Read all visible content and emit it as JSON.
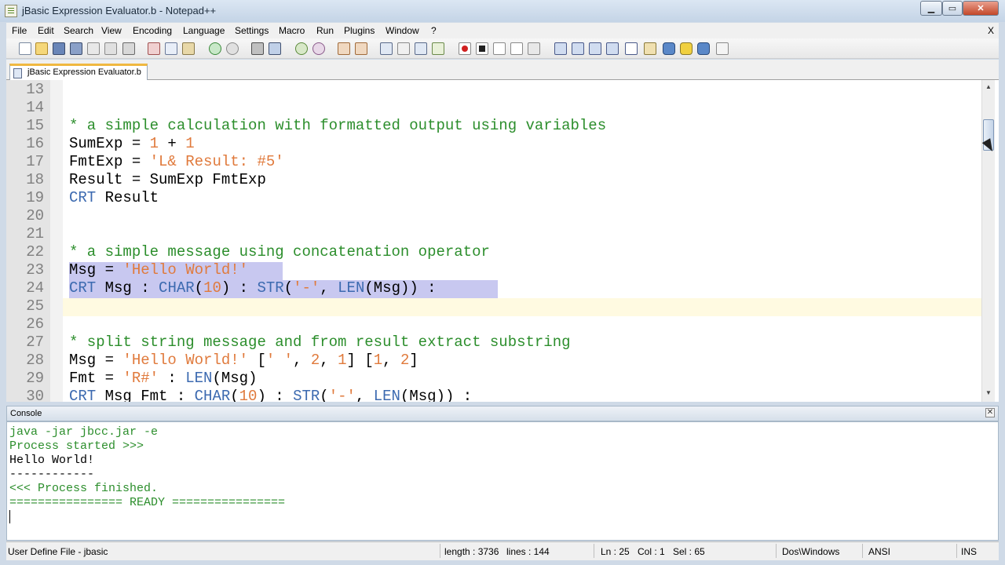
{
  "window": {
    "title": "jBasic Expression Evaluator.b - Notepad++"
  },
  "menu": {
    "items": [
      "File",
      "Edit",
      "Search",
      "View",
      "Encoding",
      "Language",
      "Settings",
      "Macro",
      "Run",
      "Plugins",
      "Window",
      "?"
    ],
    "close_label": "X"
  },
  "tab": {
    "label": "jBasic Expression Evaluator.b"
  },
  "editor": {
    "line_numbers": [
      "13",
      "14",
      "15",
      "16",
      "17",
      "18",
      "19",
      "20",
      "21",
      "22",
      "23",
      "24",
      "25",
      "26",
      "27",
      "28",
      "29",
      "30"
    ],
    "lines": [
      {
        "num": "13",
        "tokens": []
      },
      {
        "num": "14",
        "tokens": []
      },
      {
        "num": "15",
        "tokens": [
          {
            "t": "cm",
            "v": "* a simple calculation with formatted output using variables"
          }
        ]
      },
      {
        "num": "16",
        "tokens": [
          {
            "t": "op",
            "v": "SumExp = "
          },
          {
            "t": "nm",
            "v": "1"
          },
          {
            "t": "op",
            "v": " + "
          },
          {
            "t": "nm",
            "v": "1"
          }
        ]
      },
      {
        "num": "17",
        "tokens": [
          {
            "t": "op",
            "v": "FmtExp = "
          },
          {
            "t": "st",
            "v": "'L& Result: #5'"
          }
        ]
      },
      {
        "num": "18",
        "tokens": [
          {
            "t": "op",
            "v": "Result = SumExp FmtExp"
          }
        ]
      },
      {
        "num": "19",
        "tokens": [
          {
            "t": "kw",
            "v": "CRT"
          },
          {
            "t": "op",
            "v": " Result"
          }
        ]
      },
      {
        "num": "20",
        "tokens": []
      },
      {
        "num": "21",
        "tokens": []
      },
      {
        "num": "22",
        "tokens": [
          {
            "t": "cm",
            "v": "* a simple message using concatenation operator"
          }
        ]
      },
      {
        "num": "23",
        "tokens": [
          {
            "t": "op",
            "v": "Msg = "
          },
          {
            "t": "st",
            "v": "'Hello World!'"
          }
        ]
      },
      {
        "num": "24",
        "tokens": [
          {
            "t": "kw",
            "v": "CRT"
          },
          {
            "t": "op",
            "v": " Msg : "
          },
          {
            "t": "kw",
            "v": "CHAR"
          },
          {
            "t": "op",
            "v": "("
          },
          {
            "t": "nm",
            "v": "10"
          },
          {
            "t": "op",
            "v": ") : "
          },
          {
            "t": "kw",
            "v": "STR"
          },
          {
            "t": "op",
            "v": "("
          },
          {
            "t": "st",
            "v": "'-'"
          },
          {
            "t": "op",
            "v": ", "
          },
          {
            "t": "kw",
            "v": "LEN"
          },
          {
            "t": "op",
            "v": "(Msg)) :"
          }
        ]
      },
      {
        "num": "25",
        "tokens": []
      },
      {
        "num": "26",
        "tokens": []
      },
      {
        "num": "27",
        "tokens": [
          {
            "t": "cm",
            "v": "* split string message and from result extract substring"
          }
        ]
      },
      {
        "num": "28",
        "tokens": [
          {
            "t": "op",
            "v": "Msg = "
          },
          {
            "t": "st",
            "v": "'Hello World!'"
          },
          {
            "t": "op",
            "v": " ["
          },
          {
            "t": "st",
            "v": "' '"
          },
          {
            "t": "op",
            "v": ", "
          },
          {
            "t": "nm",
            "v": "2"
          },
          {
            "t": "op",
            "v": ", "
          },
          {
            "t": "nm",
            "v": "1"
          },
          {
            "t": "op",
            "v": "] ["
          },
          {
            "t": "nm",
            "v": "1"
          },
          {
            "t": "op",
            "v": ", "
          },
          {
            "t": "nm",
            "v": "2"
          },
          {
            "t": "op",
            "v": "]"
          }
        ]
      },
      {
        "num": "29",
        "tokens": [
          {
            "t": "op",
            "v": "Fmt = "
          },
          {
            "t": "st",
            "v": "'R#'"
          },
          {
            "t": "op",
            "v": " : "
          },
          {
            "t": "kw",
            "v": "LEN"
          },
          {
            "t": "op",
            "v": "(Msg)"
          }
        ]
      },
      {
        "num": "30",
        "tokens": [
          {
            "t": "kw",
            "v": "CRT"
          },
          {
            "t": "op",
            "v": " Msg Fmt : "
          },
          {
            "t": "kw",
            "v": "CHAR"
          },
          {
            "t": "op",
            "v": "("
          },
          {
            "t": "nm",
            "v": "10"
          },
          {
            "t": "op",
            "v": ") : "
          },
          {
            "t": "kw",
            "v": "STR"
          },
          {
            "t": "op",
            "v": "("
          },
          {
            "t": "st",
            "v": "'-'"
          },
          {
            "t": "op",
            "v": ", "
          },
          {
            "t": "kw",
            "v": "LEN"
          },
          {
            "t": "op",
            "v": "(Msg)) :"
          }
        ]
      }
    ]
  },
  "console": {
    "title": "Console",
    "lines": [
      {
        "style": "green",
        "text": "java -jar jbcc.jar -e"
      },
      {
        "style": "green",
        "text": "Process started >>>"
      },
      {
        "style": "black",
        "text": "Hello World!"
      },
      {
        "style": "black",
        "text": "------------"
      },
      {
        "style": "green",
        "text": "<<< Process finished."
      },
      {
        "style": "green",
        "text": "================ READY ================"
      }
    ]
  },
  "statusbar": {
    "file_type": "User Define File - jbasic",
    "length": "length : 3736",
    "lines": "lines : 144",
    "ln": "Ln : 25",
    "col": "Col : 1",
    "sel": "Sel : 65",
    "eol": "Dos\\Windows",
    "encoding": "ANSI",
    "mode": "INS"
  },
  "colors": {
    "comment": "#2c8e2c",
    "string": "#e07a3c",
    "keyword": "#3c6ab0",
    "selection": "#c8c8f0",
    "caret_line": "#fffae1"
  }
}
